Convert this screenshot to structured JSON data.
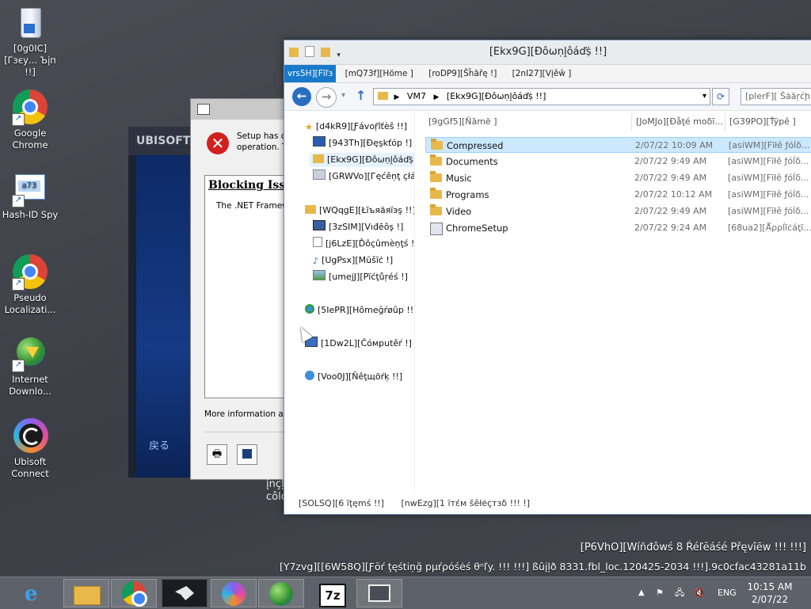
{
  "desktop": {
    "icons": [
      {
        "label": "[0g0IC][Гзєу... Ъįп !!]",
        "icon": "recycle-bin-icon"
      },
      {
        "label": "Google Chrome",
        "icon": "chrome-icon"
      },
      {
        "label": "Hash-ID Spy",
        "icon": "hash-id-icon"
      },
      {
        "label": "Pseudo Localizati...",
        "icon": "chrome-icon"
      },
      {
        "label": "Internet Downlo...",
        "icon": "internet-download-manager-icon"
      },
      {
        "label": "Ubisoft Connect",
        "icon": "ubisoft-icon"
      }
    ]
  },
  "ubisoft_window": {
    "header": "UBISOFT C",
    "back": "戻る"
  },
  "setup_dialog": {
    "message_line1": "Setup has d",
    "message_line2": "operation. T",
    "heading": "Blocking Issu",
    "body": "The .NET Framew",
    "more_info": "More information abo"
  },
  "background_text": {
    "line1": "įnçļ",
    "line2": "côlo"
  },
  "explorer": {
    "title": "[Ekx9G][Ðôωṇḽôáďṩ !!]",
    "ribbon": {
      "file": "vrs5H][Fīľз",
      "home": "[mQ73f][Ηöme ]",
      "share": "[roDP9][Šĥāřę !]",
      "view": "[2nI27][Vįêŵ ]"
    },
    "address": {
      "root": "VM7",
      "current": "[Ekx9G][Ðôωṇḽôáďṩ !!]"
    },
    "search_placeholder": "[plerF][ Šȧāŗćḩ",
    "tree": {
      "favorites": "[d4kR9][Ƒávoṝîťèŝ !!]",
      "desktop": "[943Th][Ðęşkťóp !]",
      "downloads": "[Ekx9G][Ðôωṇḽôáďṩ",
      "recent": "[GRWVo][Гęćêņţ ҫłá",
      "libraries": "[WQqgE][Łīъяäяïэş !!]",
      "videos": "[3zSIM][Vıđēôş !]",
      "documents": "[j6LzE][Ďôçûmèṇţś !",
      "music": "[UgPsx][Mŭšïċ !]",
      "pictures": "[umejJ][Ρïćţůŗéś !]",
      "homegroup": "[5IePR][Hômeğŕøûp !!]",
      "computer": "[1Dw2L][Ĉóмputěŕ !]",
      "network": "[Voo0J][Ñêţщöŕķ !!]"
    },
    "columns": {
      "name": "[9gGf5][Ňāmë ]",
      "date": "[JoMJo][Ðåţé moδī...",
      "type": "[G39PO][Ťÿpê ]"
    },
    "files": [
      {
        "name": "Compressed",
        "date": "2/07/22 10:09 AM",
        "type": "[asiWM][Fīłê ƒóĺδ..."
      },
      {
        "name": "Documents",
        "date": "2/07/22 9:49 AM",
        "type": "[asiWM][Fīłê ƒóĺδ..."
      },
      {
        "name": "Music",
        "date": "2/07/22 9:49 AM",
        "type": "[asiWM][Fīłê ƒóĺδ..."
      },
      {
        "name": "Programs",
        "date": "2/07/22 10:12 AM",
        "type": "[asiWM][Fīłê ƒóĺδ..."
      },
      {
        "name": "Video",
        "date": "2/07/22 9:49 AM",
        "type": "[asiWM][Fīłê ƒóĺδ..."
      },
      {
        "name": "ChromeSetup",
        "date": "2/07/22 9:24 AM",
        "type": "[68ua2][Ǻρρĺīċáţī..."
      }
    ],
    "status_items": "[SOLSQ][6 ïţęmś !!]",
    "status_selected": "[nwEzg][1 ïтέм šêłėçтзδ !!! !]"
  },
  "watermark": {
    "line1": "[P6VhO][Wíñđôwś 8 Ŕéľĕáśé Přęvîēw !!! !!!]",
    "line2": "[Y7zvg][[6W58Q][Ƒōŕ ţęśtiņğ pµŕρóśėś θⁿľy. !!! !!!] ßûįļð 8331.fbl_loc.120425-2034 !!!].9c0cfac43281a11b"
  },
  "taskbar": {
    "buttons": [
      "internet-explorer-icon",
      "file-explorer-icon",
      "chrome-icon",
      "app-wolf-icon",
      "ubisoft-icon",
      "internet-download-manager-icon",
      "7zip-icon",
      "remote-desktop-icon"
    ],
    "language": "ENG",
    "time": "10:15 AM",
    "date": "2/07/22"
  },
  "colors": {
    "accent": "#1979ca",
    "selection": "#cce8ff",
    "folder": "#e9b84a",
    "taskbar": "#5d6169"
  }
}
